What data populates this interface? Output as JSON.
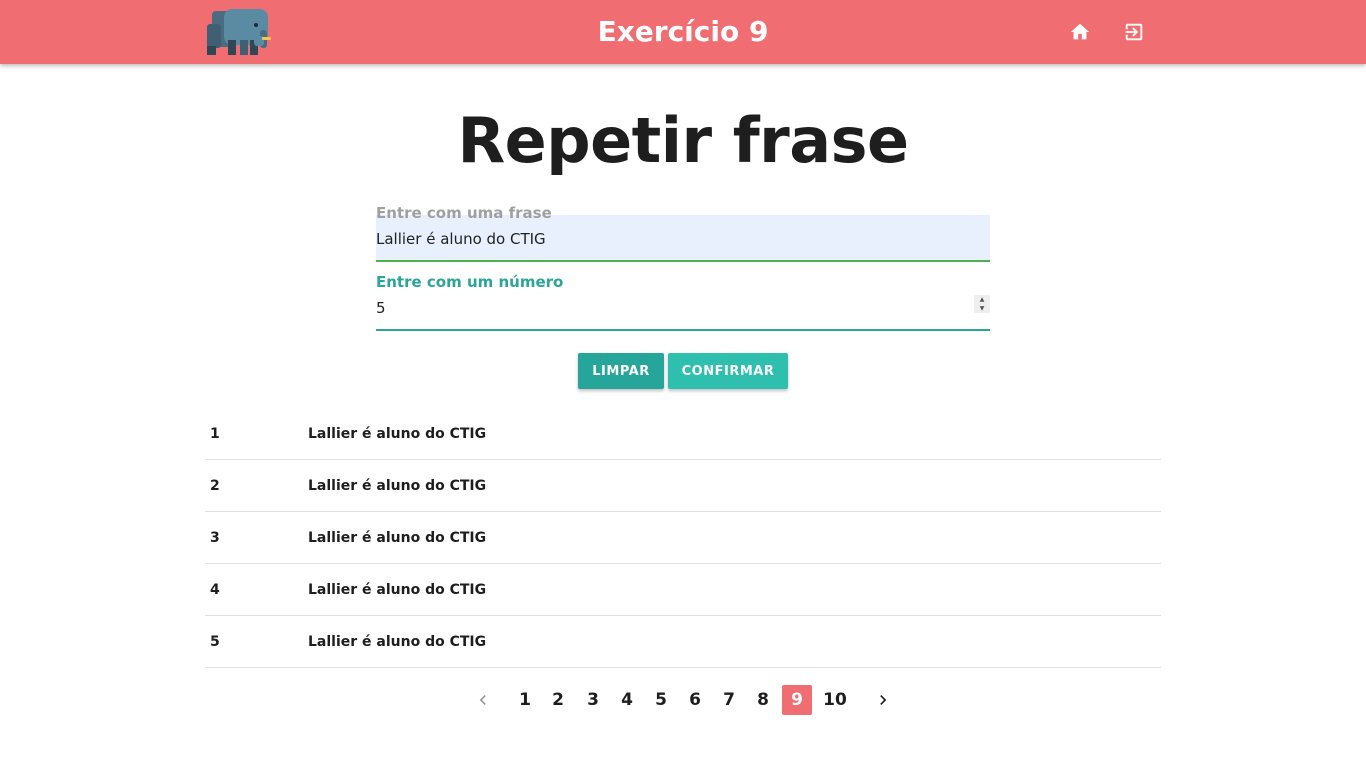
{
  "appbar": {
    "title": "Exercício 9",
    "brand_color": "#f06e72",
    "logo": "elephant-logo",
    "nav": [
      {
        "icon": "home-icon"
      },
      {
        "icon": "exit-icon"
      }
    ]
  },
  "page": {
    "heading": "Repetir frase"
  },
  "form": {
    "frase_label": "Entre com uma frase",
    "frase_value": "Lallier é aluno do CTIG",
    "numero_label": "Entre com um número",
    "numero_value": "5",
    "accent_color": "#2aa597",
    "limpar_label": "LIMPAR",
    "confirmar_label": "CONFIRMAR"
  },
  "results": [
    {
      "n": "1",
      "text": "Lallier é aluno do CTIG"
    },
    {
      "n": "2",
      "text": "Lallier é aluno do CTIG"
    },
    {
      "n": "3",
      "text": "Lallier é aluno do CTIG"
    },
    {
      "n": "4",
      "text": "Lallier é aluno do CTIG"
    },
    {
      "n": "5",
      "text": "Lallier é aluno do CTIG"
    }
  ],
  "pagination": {
    "pages": [
      "1",
      "2",
      "3",
      "4",
      "5",
      "6",
      "7",
      "8",
      "9",
      "10"
    ],
    "current": "9",
    "prev_icon": "chevron-left-icon",
    "next_icon": "chevron-right-icon"
  }
}
